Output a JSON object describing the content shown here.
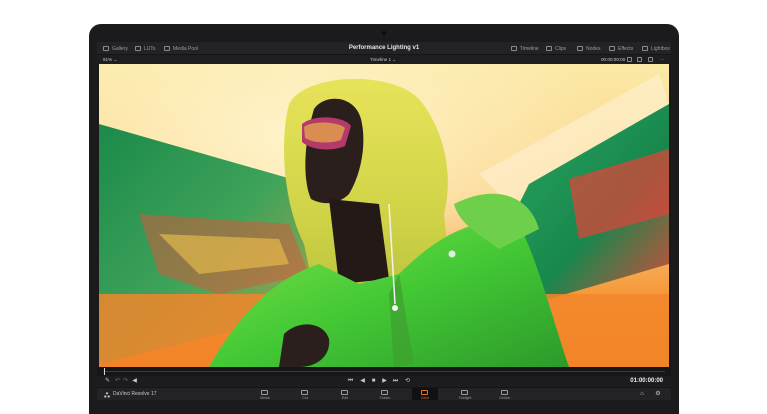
{
  "app": {
    "name": "DaVinci Resolve 17",
    "project_title": "Performance Lighting v1"
  },
  "top_left_tabs": [
    {
      "label": "Gallery",
      "icon": "gallery-icon"
    },
    {
      "label": "LUTs",
      "icon": "luts-icon"
    },
    {
      "label": "Media Pool",
      "icon": "media-pool-icon"
    }
  ],
  "top_right_tabs": [
    {
      "label": "Timeline",
      "icon": "timeline-icon"
    },
    {
      "label": "Clips",
      "icon": "clips-icon"
    },
    {
      "label": "Nodes",
      "icon": "nodes-icon"
    },
    {
      "label": "Effects",
      "icon": "effects-icon"
    },
    {
      "label": "Lightbox",
      "icon": "lightbox-icon"
    }
  ],
  "viewer": {
    "zoom": "91%",
    "timeline_name": "Timeline 1",
    "timecode": "00:00:00:00"
  },
  "transport": {
    "timecode": "01:00:00:00",
    "buttons": [
      "skip-back-icon",
      "step-back-icon",
      "stop-icon",
      "play-icon",
      "skip-forward-icon",
      "loop-icon"
    ]
  },
  "pages": [
    {
      "label": "Media",
      "icon": "media-page-icon",
      "active": false
    },
    {
      "label": "Cut",
      "icon": "cut-page-icon",
      "active": false
    },
    {
      "label": "Edit",
      "icon": "edit-page-icon",
      "active": false
    },
    {
      "label": "Fusion",
      "icon": "fusion-page-icon",
      "active": false
    },
    {
      "label": "Color",
      "icon": "color-page-icon",
      "active": true
    },
    {
      "label": "Fairlight",
      "icon": "fairlight-page-icon",
      "active": false
    },
    {
      "label": "Deliver",
      "icon": "deliver-page-icon",
      "active": false
    }
  ],
  "colors": {
    "accent": "#e0742a",
    "ui_bg": "#232326"
  }
}
